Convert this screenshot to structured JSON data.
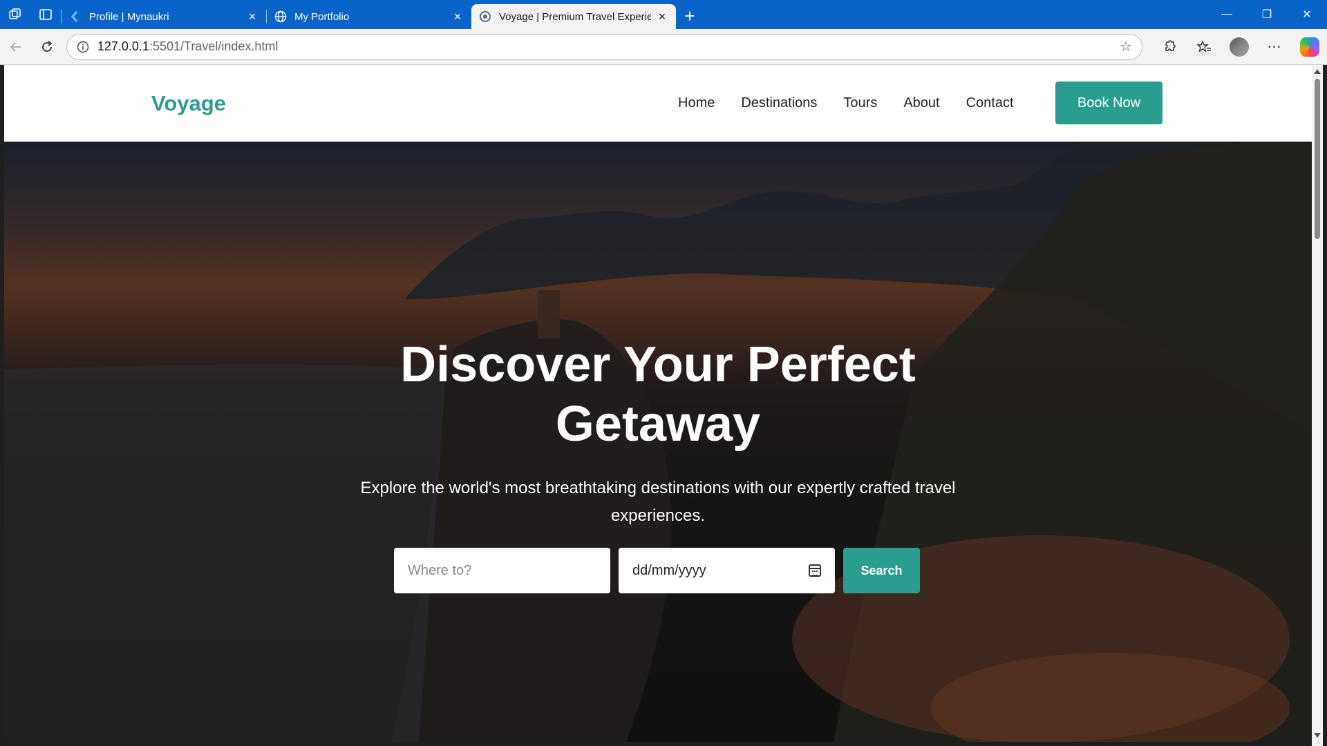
{
  "browser": {
    "tabs": [
      {
        "title": "Profile | Mynaukri",
        "active": false
      },
      {
        "title": "My Portfolio",
        "active": false
      },
      {
        "title": "Voyage | Premium Travel Experien",
        "active": true
      }
    ],
    "url_host": "127.0.0.1",
    "url_rest": ":5501/Travel/index.html"
  },
  "site": {
    "logo": "Voyage",
    "nav": [
      "Home",
      "Destinations",
      "Tours",
      "About",
      "Contact"
    ],
    "cta": "Book Now",
    "accent": "#2a9d8f"
  },
  "hero": {
    "title": "Discover Your Perfect Getaway",
    "subtitle": "Explore the world's most breathtaking destinations with our expertly crafted travel experiences.",
    "destination_placeholder": "Where to?",
    "date_value": "dd/mm/yyyy",
    "search_label": "Search"
  }
}
